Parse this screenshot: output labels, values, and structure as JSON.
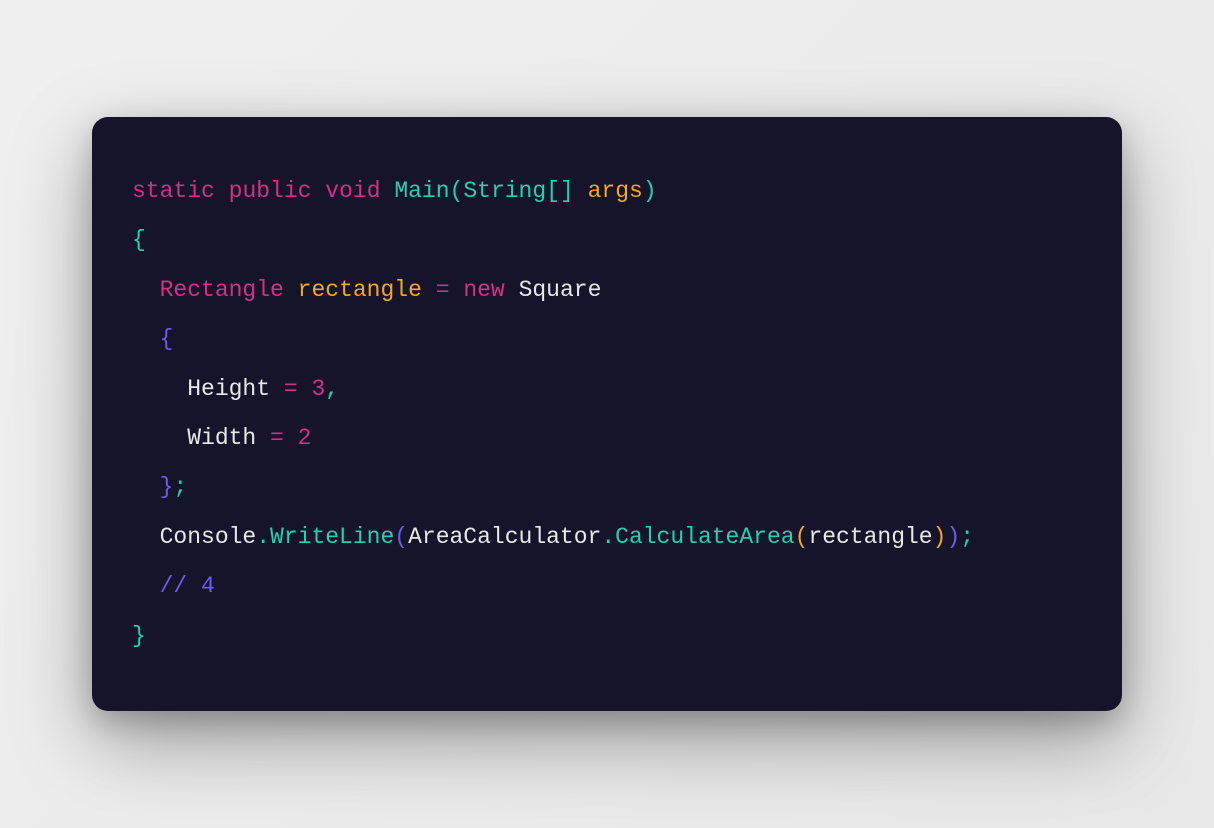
{
  "code": {
    "line1": {
      "t1": "static",
      "t2": "public",
      "t3": "void",
      "t4": "Main",
      "t5": "(",
      "t6": "String",
      "t7": "[]",
      "t8": "args",
      "t9": ")"
    },
    "line2": {
      "t1": "{"
    },
    "line3": {
      "indent": "  ",
      "t1": "Rectangle",
      "t2": "rectangle",
      "t3": "=",
      "t4": "new",
      "t5": "Square"
    },
    "line4": {
      "indent": "  ",
      "t1": "{"
    },
    "line5": {
      "indent": "    ",
      "t1": "Height",
      "t2": "=",
      "t3": "3",
      "t4": ","
    },
    "line6": {
      "indent": "    ",
      "t1": "Width",
      "t2": "=",
      "t3": "2"
    },
    "line7": {
      "indent": "  ",
      "t1": "}",
      "t2": ";"
    },
    "line8": {
      "indent": "  ",
      "t1": "Console",
      "t2": ".",
      "t3": "WriteLine",
      "t4": "(",
      "t5": "AreaCalculator",
      "t6": ".",
      "t7": "CalculateArea",
      "t8": "(",
      "t9": "rectangle",
      "t10": ")",
      "t11": ")",
      "t12": ";"
    },
    "line9": {
      "indent": "  ",
      "t1": "// 4"
    },
    "line10": {
      "t1": "}"
    }
  }
}
